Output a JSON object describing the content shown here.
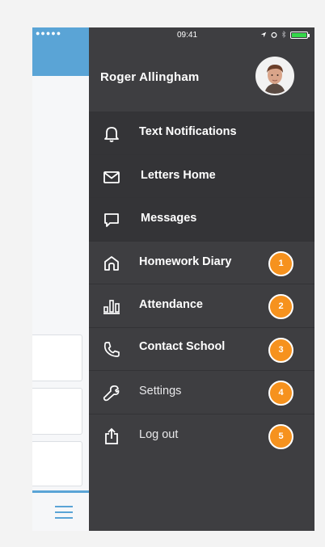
{
  "status_bar": {
    "signal": "●●●●● ",
    "time": "09:41"
  },
  "profile": {
    "name": "Roger Allingham"
  },
  "menu": {
    "items": [
      {
        "label": "Text Notifications",
        "icon": "bell-icon",
        "badge": null
      },
      {
        "label": "Letters Home",
        "icon": "envelope-icon",
        "badge": null
      },
      {
        "label": "Messages",
        "icon": "chat-bubble-icon",
        "badge": null
      },
      {
        "label": "Homework Diary",
        "icon": "home-icon",
        "badge": "1"
      },
      {
        "label": "Attendance",
        "icon": "bar-chart-icon",
        "badge": "2"
      },
      {
        "label": "Contact School",
        "icon": "phone-icon",
        "badge": "3"
      },
      {
        "label": "Settings",
        "icon": "wrench-icon",
        "badge": "4"
      },
      {
        "label": "Log out",
        "icon": "share-upload-icon",
        "badge": "5"
      }
    ]
  },
  "colors": {
    "drawer_bg": "#3e3e41",
    "drawer_bg_dark": "#343437",
    "accent_blue": "#5aa4d6",
    "badge_orange": "#f6921e",
    "battery_green": "#35d84a"
  }
}
